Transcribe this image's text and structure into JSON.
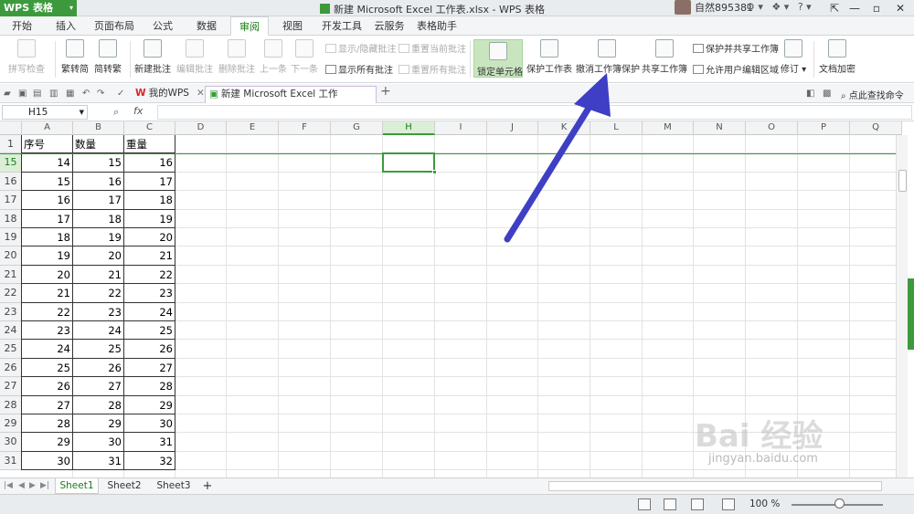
{
  "app": {
    "name": "WPS 表格",
    "window_title": "新建 Microsoft Excel 工作表.xlsx - WPS 表格",
    "username": "自然895381"
  },
  "menu": [
    "开始",
    "插入",
    "页面布局",
    "公式",
    "数据",
    "审阅",
    "视图",
    "开发工具",
    "云服务",
    "表格助手"
  ],
  "ribbon": {
    "spell": "拼写检查",
    "trad": "繁转简",
    "simp": "简转繁",
    "new_comment": "新建批注",
    "edit_comment": "编辑批注",
    "delete_comment": "删除批注",
    "prev": "上一条",
    "next": "下一条",
    "show_hide": "显示/隐藏批注",
    "show_all": "显示所有批注",
    "reset_current": "重置当前批注",
    "reset_all": "重置所有批注",
    "lock_cell": "锁定单元格",
    "protect_sheet": "保护工作表",
    "unprotect_book": "撤消工作簿保护",
    "share_book": "共享工作簿",
    "protect_share": "保护并共享工作簿",
    "allow_edit": "允许用户编辑区域",
    "revise": "修订",
    "encrypt": "文档加密"
  },
  "doc_tabs": [
    {
      "label": "我的WPS",
      "active": false
    },
    {
      "label": "新建 Microsoft Excel 工作表.xlsx",
      "active": true
    }
  ],
  "search_cmd": "点此查找命令",
  "formula_bar": {
    "name_box": "H15",
    "fx": "fx",
    "value": ""
  },
  "columns": [
    "A",
    "B",
    "C",
    "D",
    "E",
    "F",
    "G",
    "H",
    "I",
    "J",
    "K",
    "L",
    "M",
    "N",
    "O",
    "P",
    "Q"
  ],
  "selected_column": "H",
  "header_row": {
    "row": "1",
    "cells": [
      "序号",
      "数量",
      "重量"
    ]
  },
  "rows": [
    {
      "row": "15",
      "a": "14",
      "b": "15",
      "c": "16"
    },
    {
      "row": "16",
      "a": "15",
      "b": "16",
      "c": "17"
    },
    {
      "row": "17",
      "a": "16",
      "b": "17",
      "c": "18"
    },
    {
      "row": "18",
      "a": "17",
      "b": "18",
      "c": "19"
    },
    {
      "row": "19",
      "a": "18",
      "b": "19",
      "c": "20"
    },
    {
      "row": "20",
      "a": "19",
      "b": "20",
      "c": "21"
    },
    {
      "row": "21",
      "a": "20",
      "b": "21",
      "c": "22"
    },
    {
      "row": "22",
      "a": "21",
      "b": "22",
      "c": "23"
    },
    {
      "row": "23",
      "a": "22",
      "b": "23",
      "c": "24"
    },
    {
      "row": "24",
      "a": "23",
      "b": "24",
      "c": "25"
    },
    {
      "row": "25",
      "a": "24",
      "b": "25",
      "c": "26"
    },
    {
      "row": "26",
      "a": "25",
      "b": "26",
      "c": "27"
    },
    {
      "row": "27",
      "a": "26",
      "b": "27",
      "c": "28"
    },
    {
      "row": "28",
      "a": "27",
      "b": "28",
      "c": "29"
    },
    {
      "row": "29",
      "a": "28",
      "b": "29",
      "c": "30"
    },
    {
      "row": "30",
      "a": "29",
      "b": "30",
      "c": "31"
    },
    {
      "row": "31",
      "a": "30",
      "b": "31",
      "c": "32"
    }
  ],
  "sheets": [
    "Sheet1",
    "Sheet2",
    "Sheet3"
  ],
  "active_sheet": "Sheet1",
  "zoom": "100 %",
  "watermark": {
    "text": "Bai 经验",
    "sub": "jingyan.baidu.com"
  },
  "colors": {
    "accent": "#3c9a3c",
    "arrow": "#3e3fc4"
  }
}
